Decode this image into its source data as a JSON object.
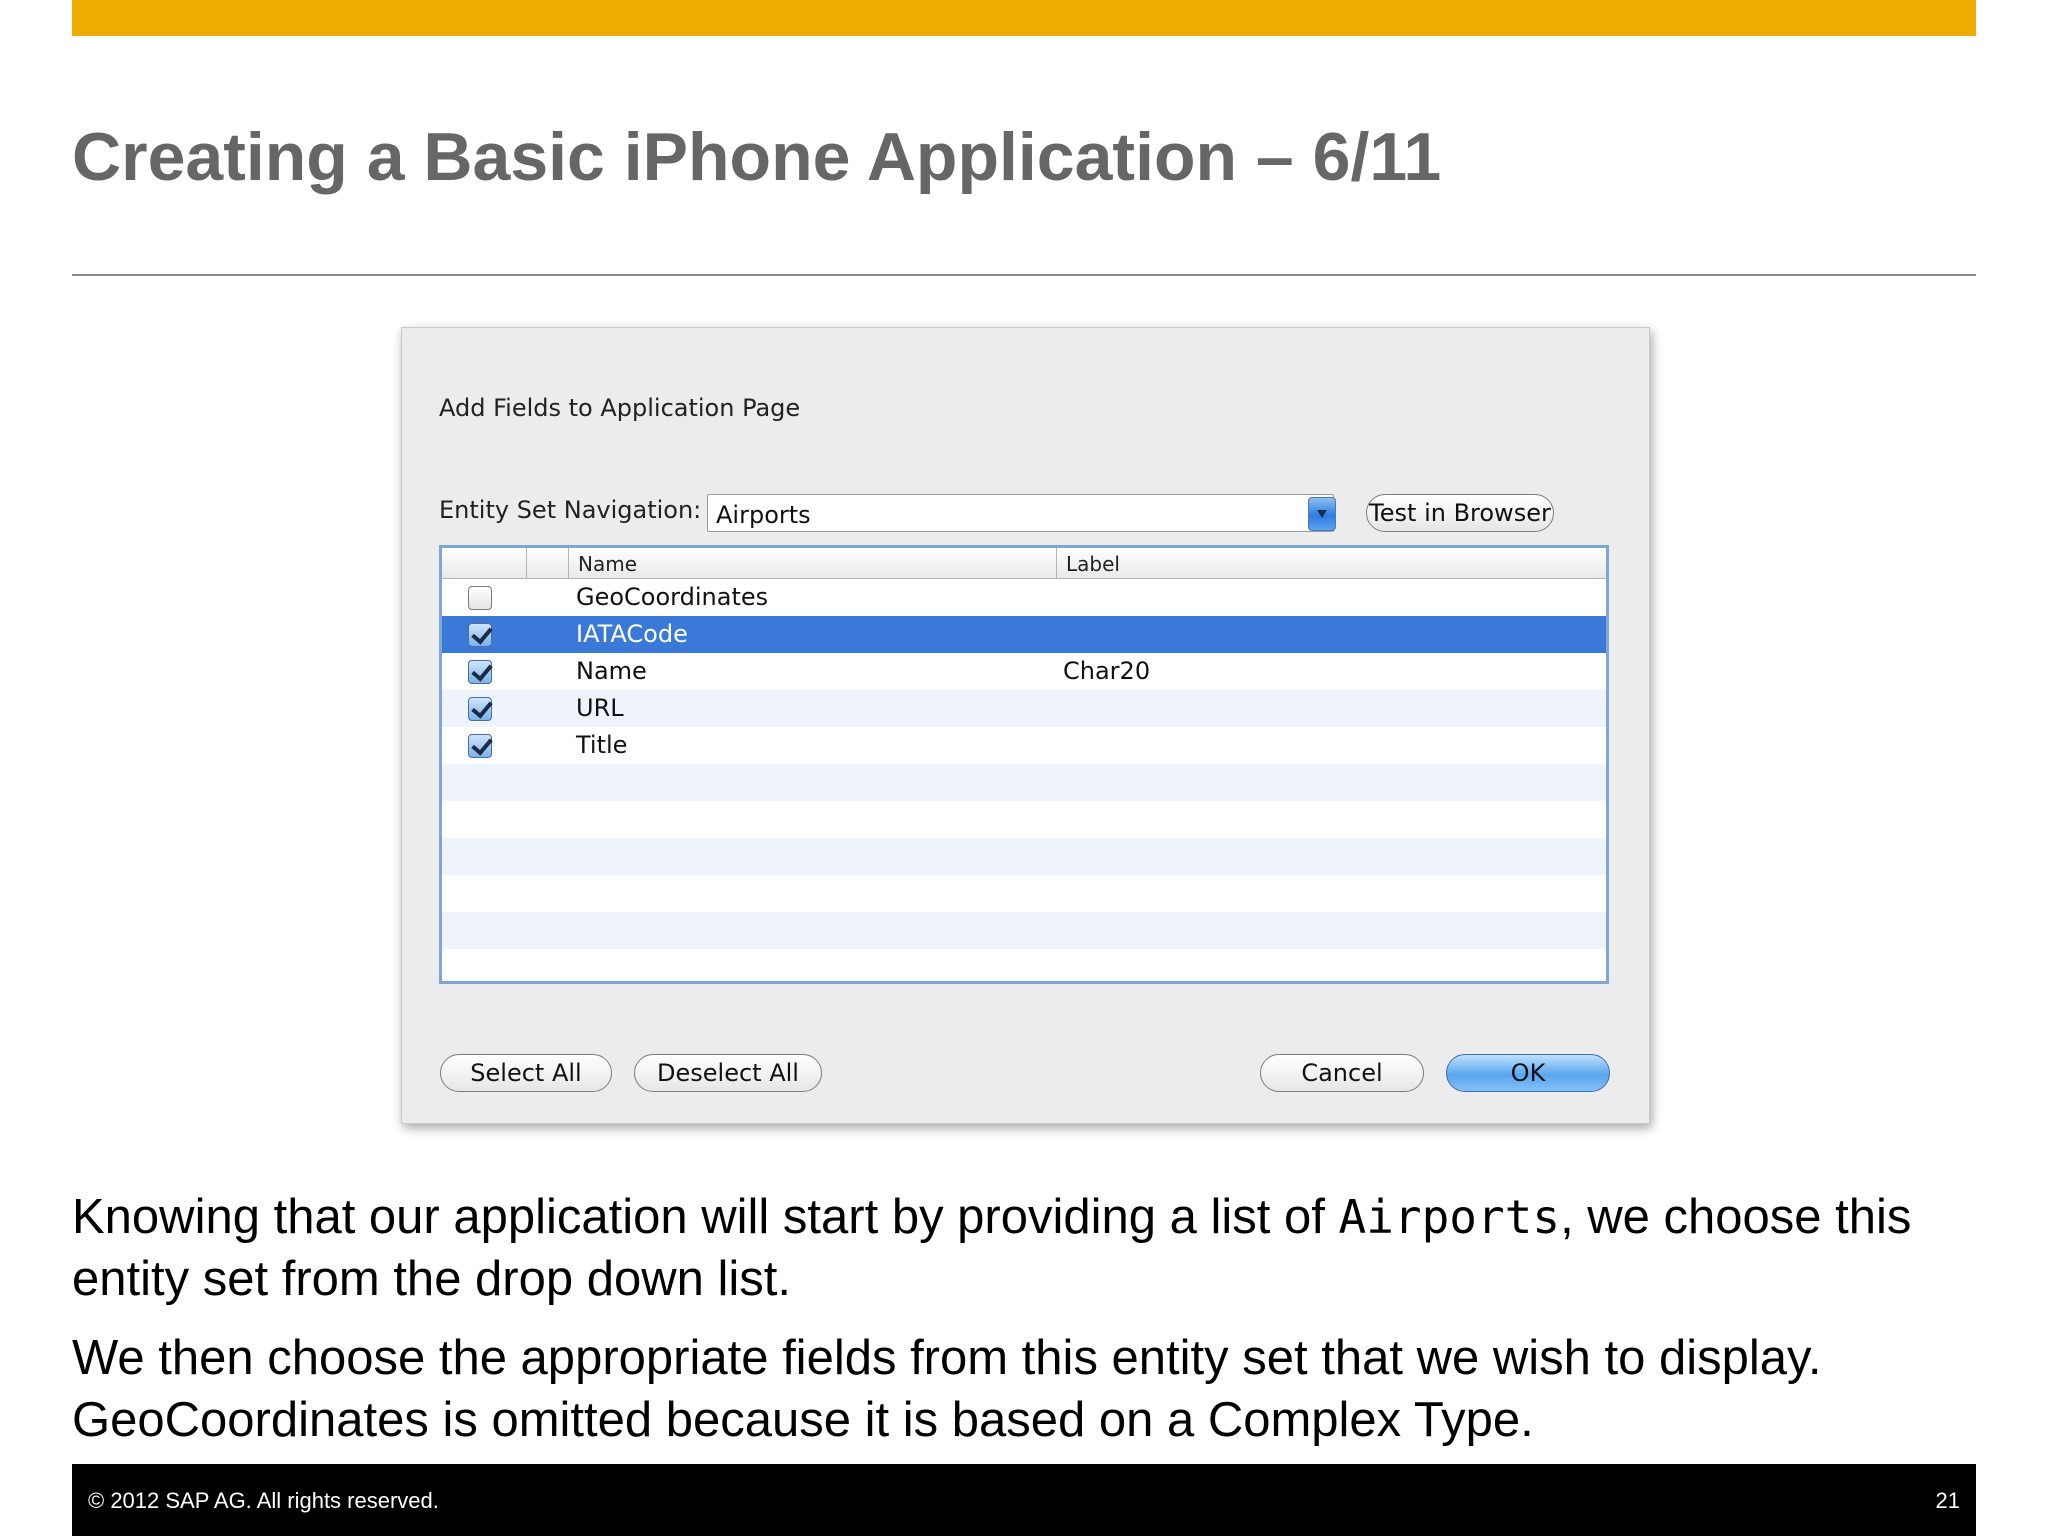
{
  "slide": {
    "title": "Creating a Basic iPhone Application – 6/11"
  },
  "dialog": {
    "title": "Add Fields to Application Page",
    "entity_set_label": "Entity Set Navigation:",
    "entity_set_value": "Airports",
    "test_button": "Test in Browser",
    "table": {
      "columns": [
        "Name",
        "Label"
      ],
      "rows": [
        {
          "checked": false,
          "name": "GeoCoordinates",
          "label": "",
          "selected": false
        },
        {
          "checked": true,
          "name": "IATACode",
          "label": "",
          "selected": true
        },
        {
          "checked": true,
          "name": "Name",
          "label": "Char20",
          "selected": false
        },
        {
          "checked": true,
          "name": "URL",
          "label": "",
          "selected": false
        },
        {
          "checked": true,
          "name": "Title",
          "label": "",
          "selected": false
        }
      ],
      "selected_row_color": "#3b79d8"
    },
    "buttons": {
      "select_all": "Select All",
      "deselect_all": "Deselect All",
      "cancel": "Cancel",
      "ok": "OK"
    }
  },
  "body_text": {
    "p1_before": "Knowing that our application will start by providing a list of ",
    "p1_code": "Airports",
    "p1_after": ", we choose this entity set from the drop down list.",
    "p2": "We then choose the appropriate fields from this entity set that we wish to display. GeoCoordinates is omitted because it is based on a Complex Type."
  },
  "footer": {
    "copyright": "©  2012 SAP AG. All rights reserved.",
    "page_number": "21"
  },
  "colors": {
    "accent_bar": "#f0ab00",
    "title_gray": "#666666",
    "footer_bg": "#000000"
  }
}
